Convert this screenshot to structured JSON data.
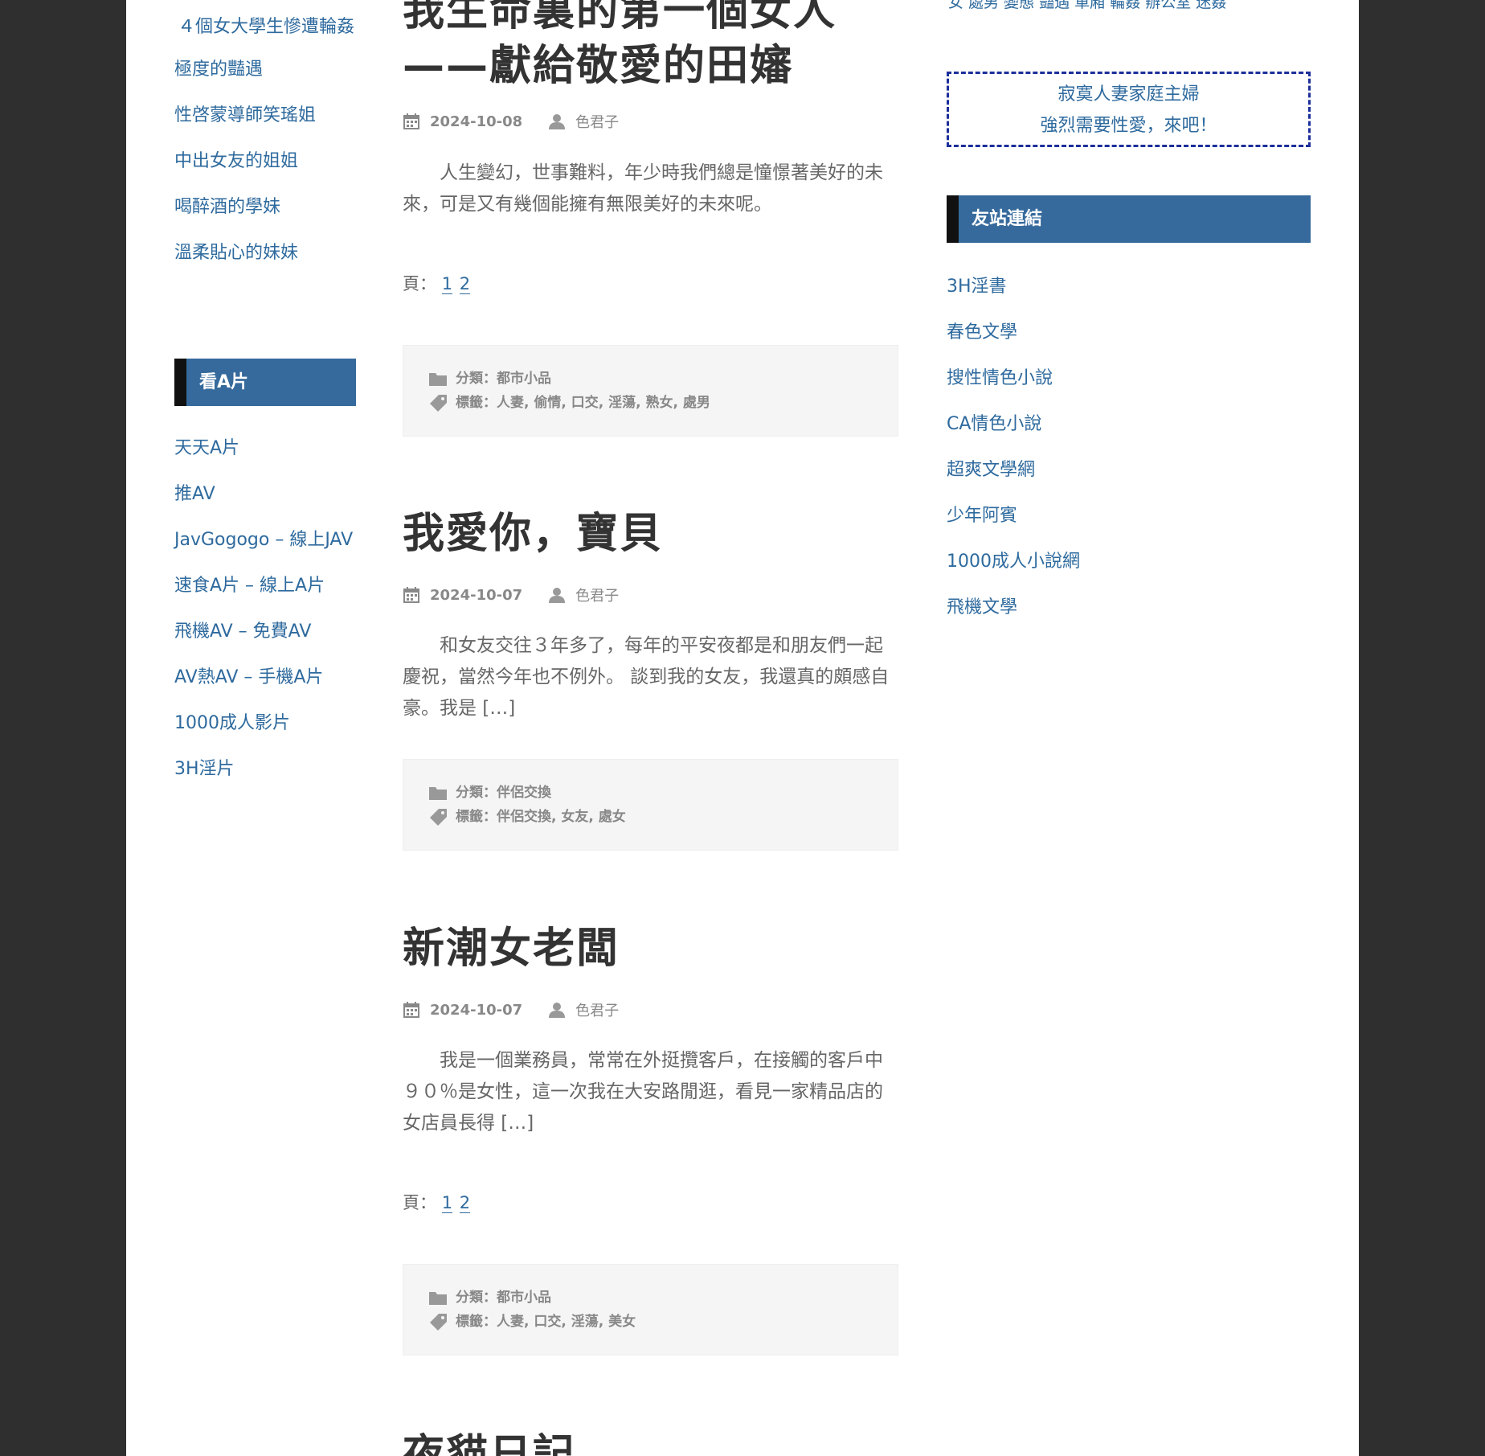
{
  "left_sidebar": {
    "top_links": [
      "４個女大學生慘遭輪姦",
      "極度的豔遇",
      "性啓蒙導師笑瑤姐",
      "中出女友的姐姐",
      "喝醉酒的學妹",
      "溫柔貼心的妹妹"
    ],
    "video_widget_title": "看A片",
    "video_links": [
      "天天A片",
      "推AV",
      "JavGogogo – 線上JAV",
      "速食A片 – 線上A片",
      "飛機AV – 免費AV",
      "AV熱AV – 手機A片",
      "1000成人影片",
      "3H淫片"
    ]
  },
  "posts": [
    {
      "title_line1": "我生命裏的第一個女人",
      "title_line2": "——獻給敬愛的田嬸",
      "date": "2024-10-08",
      "author": "色君子",
      "excerpt": "人生變幻，世事難料，年少時我們總是憧憬著美好的未來，可是又有幾個能擁有無限美好的未來呢。",
      "pages_label": "頁：",
      "page_1": "1",
      "page_2": "2",
      "category": "分類：都市小品",
      "tags": "標籤：人妻, 偷情, 口交, 淫蕩, 熟女, 處男"
    },
    {
      "title": "我愛你，寶貝",
      "date": "2024-10-07",
      "author": "色君子",
      "excerpt": "和女友交往３年多了，每年的平安夜都是和朋友們一起慶祝，當然今年也不例外。 談到我的女友，我還真的頗感自豪。我是 […]",
      "category": "分類：伴侶交換",
      "tags": "標籤：伴侶交換, 女友, 處女"
    },
    {
      "title": "新潮女老闆",
      "date": "2024-10-07",
      "author": "色君子",
      "excerpt": "我是一個業務員，常常在外挺攬客戶，在接觸的客戶中９０％是女性，這一次我在大安路閒逛，看見一家精品店的女店員長得 […]",
      "pages_label": "頁：",
      "page_1": "1",
      "page_2": "2",
      "category": "分類：都市小品",
      "tags": "標籤：人妻, 口交, 淫蕩, 美女"
    },
    {
      "title": "夜貓日記"
    }
  ],
  "right_sidebar": {
    "tagcloud": "女 處男 變態 豔遇 車廂 輪姦 辦公室 迷姦",
    "ad_line1": "寂寞人妻家庭主婦",
    "ad_line2": "強烈需要性愛，來吧！",
    "links_widget_title": "友站連結",
    "links": [
      "3H淫書",
      "春色文學",
      "搜性情色小說",
      "CA情色小說",
      "超爽文學網",
      "少年阿賓",
      "1000成人小說網",
      "飛機文學"
    ]
  }
}
